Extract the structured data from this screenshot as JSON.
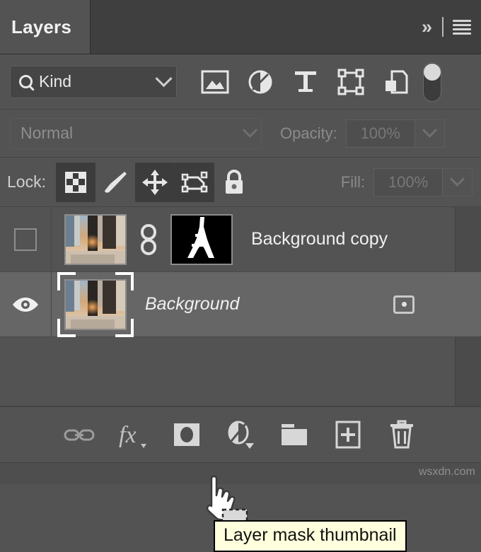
{
  "panel": {
    "tab_label": "Layers",
    "collapse_icon": "double-chevron-right-icon",
    "menu_icon": "hamburger-menu-icon"
  },
  "filter": {
    "search_icon": "magnifier-icon",
    "kind_value": "Kind",
    "kind_caret": "chevron-down-icon",
    "type_filters": [
      {
        "name": "pixel-layers-filter",
        "icon": "image-icon"
      },
      {
        "name": "adjustment-layers-filter",
        "icon": "half-circle-icon"
      },
      {
        "name": "type-layers-filter",
        "icon": "text-t-icon"
      },
      {
        "name": "shape-layers-filter",
        "icon": "shape-bounding-box-icon"
      },
      {
        "name": "smart-object-filter",
        "icon": "smart-object-icon"
      }
    ],
    "toggle": {
      "name": "filter-enable-toggle",
      "state": "on"
    }
  },
  "blend": {
    "mode": "Normal",
    "mode_caret": "chevron-down-icon",
    "opacity_label": "Opacity:",
    "opacity_value": "100%",
    "opacity_caret": "chevron-down-icon"
  },
  "lock": {
    "label": "Lock:",
    "buttons": [
      {
        "name": "lock-transparent-pixels",
        "icon": "checkerboard-icon",
        "active": true
      },
      {
        "name": "lock-image-pixels",
        "icon": "brush-icon",
        "active": false
      },
      {
        "name": "lock-position",
        "icon": "move-arrows-icon",
        "active": true
      },
      {
        "name": "lock-artboard-nesting",
        "icon": "artboard-icon",
        "active": true
      },
      {
        "name": "lock-all",
        "icon": "padlock-icon",
        "active": false
      }
    ],
    "fill_label": "Fill:",
    "fill_value": "100%",
    "fill_caret": "chevron-down-icon"
  },
  "layers": [
    {
      "name": "Background copy",
      "visible": false,
      "selected": false,
      "italic": false,
      "has_mask": true,
      "linked": true,
      "locked_badge": false,
      "visibility_icon": "empty-checkbox-icon",
      "link_icon": "link-chain-icon",
      "mask_alt": "white-tower-silhouette-mask"
    },
    {
      "name": "Background",
      "visible": true,
      "selected": true,
      "italic": true,
      "has_mask": false,
      "linked": false,
      "locked_badge": true,
      "visibility_icon": "eye-icon",
      "lock_badge_icon": "lock-badge-icon"
    }
  ],
  "tooltip": {
    "text": "Layer mask thumbnail",
    "bg_color": "#ffffdd",
    "border_color": "#000000"
  },
  "cursor": {
    "icon": "hand-pointer-with-selection-icon"
  },
  "bottom_toolbar": [
    {
      "name": "link-layers-button",
      "icon": "link-icon"
    },
    {
      "name": "layer-style-button",
      "icon": "fx-icon"
    },
    {
      "name": "add-layer-mask-button",
      "icon": "mask-icon"
    },
    {
      "name": "new-adjustment-layer-button",
      "icon": "half-circle-icon"
    },
    {
      "name": "new-group-button",
      "icon": "folder-icon"
    },
    {
      "name": "new-layer-button",
      "icon": "plus-page-icon"
    },
    {
      "name": "delete-layer-button",
      "icon": "trash-icon"
    }
  ],
  "watermark": "wsxdn.com",
  "colors": {
    "panel_bg": "#535353",
    "header_bg": "#3f3f3f",
    "selected_row": "#666666",
    "text": "#f0f0f0",
    "dim_text": "#8b8b8b"
  }
}
